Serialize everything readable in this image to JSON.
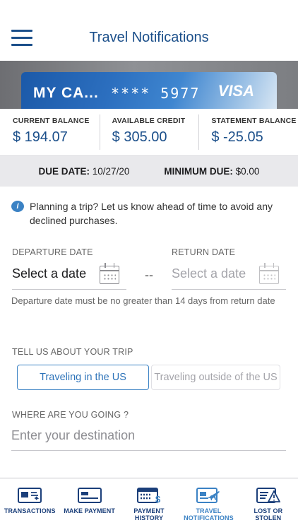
{
  "header": {
    "title": "Travel Notifications",
    "menu_icon": "hamburger-menu-icon"
  },
  "card": {
    "name": "MY CA...",
    "number": "**** 5977",
    "brand": "VISA"
  },
  "balances": [
    {
      "label": "CURRENT BALANCE",
      "value": "$ 194.07"
    },
    {
      "label": "AVAILABLE CREDIT",
      "value": "$ 305.00"
    },
    {
      "label": "STATEMENT BALANCE",
      "value": "$ -25.05"
    }
  ],
  "due": {
    "date_label": "DUE DATE:",
    "date_value": "10/27/20",
    "min_label": "MINIMUM DUE:",
    "min_value": "$0.00"
  },
  "info": {
    "text": "Planning a trip? Let us know ahead of time to avoid any declined purchases."
  },
  "dates": {
    "departure_label": "DEPARTURE DATE",
    "departure_value": "Select a date",
    "separator": "--",
    "return_label": "RETURN DATE",
    "return_value": "Select a date",
    "hint": "Departure date must be no greater than 14 days from return date"
  },
  "trip": {
    "label": "TELL US ABOUT YOUR TRIP",
    "options": [
      "Traveling in the US",
      "Traveling outside of the US"
    ],
    "selected": "Traveling in the US"
  },
  "destination": {
    "label": "WHERE ARE YOU GOING ?",
    "placeholder": "Enter your destination",
    "value": ""
  },
  "nav": [
    {
      "label": "TRANSACTIONS",
      "icon": "transactions-icon"
    },
    {
      "label": "MAKE PAYMENT",
      "icon": "card-payment-icon"
    },
    {
      "label": "PAYMENT HISTORY",
      "icon": "payment-history-icon"
    },
    {
      "label": "TRAVEL NOTIFICATIONS",
      "icon": "travel-notifications-icon",
      "active": true
    },
    {
      "label": "LOST OR STOLEN",
      "icon": "lost-stolen-icon"
    }
  ],
  "colors": {
    "primary": "#1b4f8a",
    "accent": "#3b82c4",
    "muted": "#8e8e93"
  }
}
